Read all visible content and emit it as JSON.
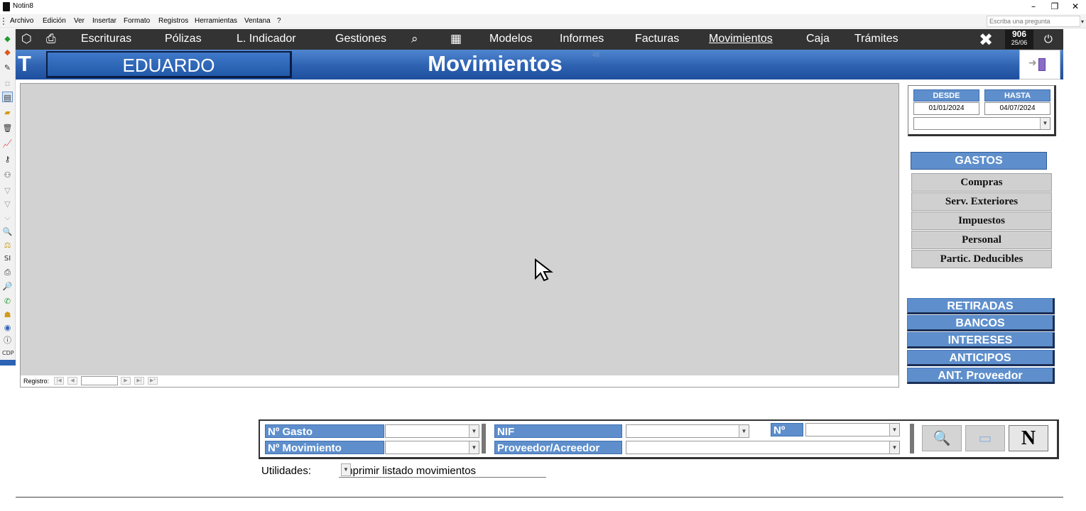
{
  "window": {
    "title": "Notin8"
  },
  "menubar": {
    "items": [
      "Archivo",
      "Edición",
      "Ver",
      "Insertar",
      "Formato",
      "Registros",
      "Herramientas",
      "Ventana",
      "?"
    ],
    "ask_placeholder": "Escriba una pregunta"
  },
  "nav": {
    "items": [
      "Escrituras",
      "Pólizas",
      "L. Indicador",
      "Gestiones",
      "Modelos",
      "Informes",
      "Facturas",
      "Movimientos",
      "Caja",
      "Trámites"
    ],
    "active": "Movimientos",
    "badge_number": "906",
    "badge_date": "25/06"
  },
  "banner": {
    "letter": "T",
    "user": "EDUARDO",
    "title": "Movimientos",
    "faint": "48"
  },
  "records": {
    "label": "Registro:"
  },
  "dates": {
    "desde_label": "DESDE",
    "hasta_label": "HASTA",
    "desde": "01/01/2024",
    "hasta": "04/07/2024"
  },
  "gastos": {
    "header": "GASTOS",
    "buttons": [
      "Compras",
      "Serv. Exteriores",
      "Impuestos",
      "Personal",
      "Partic. Deducibles"
    ]
  },
  "actions": [
    "RETIRADAS",
    "BANCOS",
    "INTERESES",
    "ANTICIPOS",
    "ANT. Proveedor"
  ],
  "filters": {
    "n_gasto": "Nº Gasto",
    "n_movimiento": "Nº Movimiento",
    "nif": "NIF",
    "proveedor": "Proveedor/Acreedor",
    "numero": "Nº",
    "new_button": "N"
  },
  "utilidades": {
    "label": "Utilidades:",
    "value": "Imprimir listado movimientos"
  },
  "colors": {
    "nav_bg": "#333333",
    "banner_blue": "#2e62b1",
    "label_blue": "#5e8fcc",
    "grid_grey": "#d2d2d2"
  }
}
